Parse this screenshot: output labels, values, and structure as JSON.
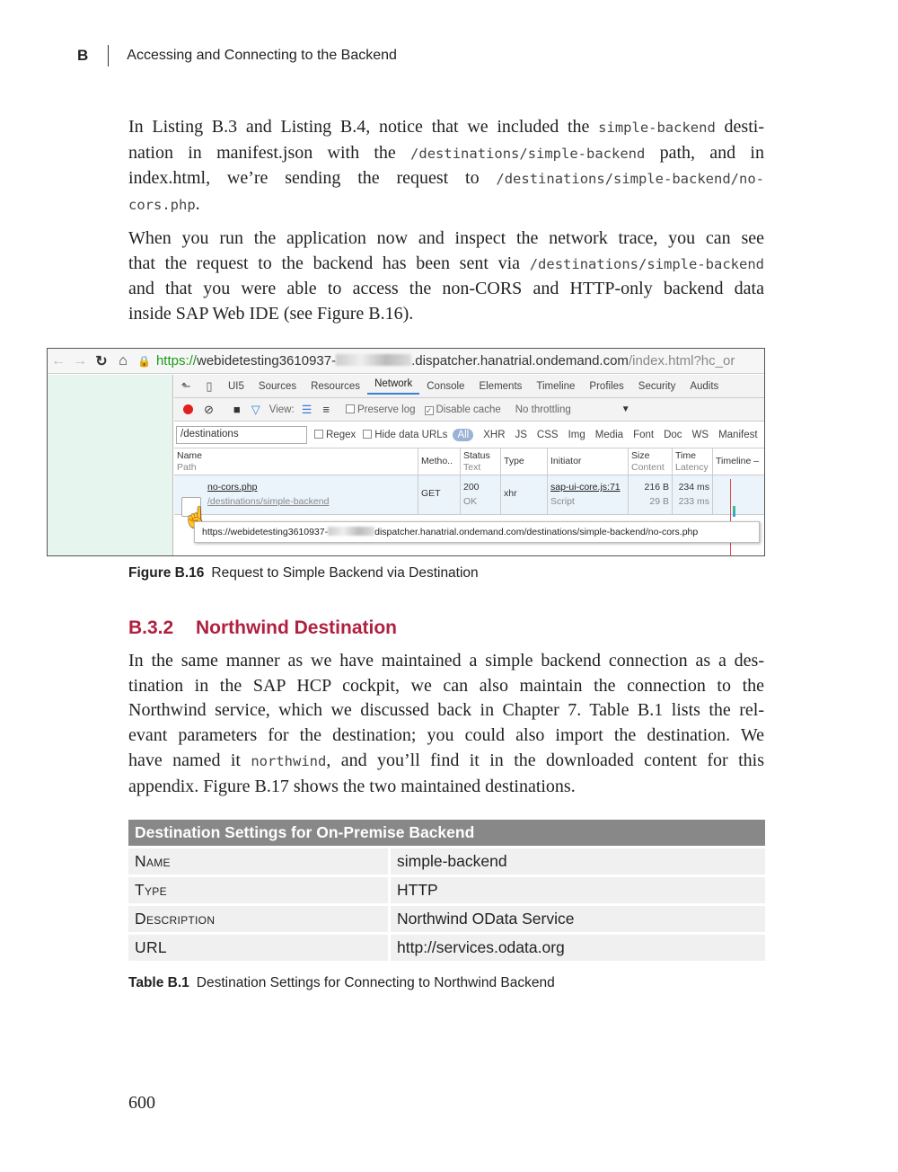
{
  "header": {
    "chapter_letter": "B",
    "chapter_title": "Accessing and Connecting to the Backend"
  },
  "para1": {
    "l1a": "In Listing B.3 and Listing B.4, notice that we included the ",
    "l1code": "simple-backend",
    "l1b": " desti-",
    "l2a": "nation in manifest.json with the ",
    "l2code": "/destinations/simple-backend",
    "l2b": " path, and in",
    "l3a": "index.html, we’re sending the request to ",
    "l3code": "/destinations/simple-backend/no-",
    "l4code": "cors.php",
    "l4b": "."
  },
  "para2": {
    "l1": "When you run the application now and inspect the network trace, you can see",
    "l2a": "that the request to the backend has been sent via ",
    "l2code": "/destinations/simple-backend",
    "l3": "and that you were able to access the non-CORS and HTTP-only backend data",
    "l4": "inside SAP Web IDE (see Figure B.16)."
  },
  "screenshot": {
    "url_scheme": "https://",
    "url_host_a": "webidetesting3610937-",
    "url_host_b": ".dispatcher.hanatrial.ondemand.com",
    "url_path": "/index.html?hc_or",
    "tabs": [
      "UI5",
      "Sources",
      "Resources",
      "Network",
      "Console",
      "Elements",
      "Timeline",
      "Profiles",
      "Security",
      "Audits"
    ],
    "toolbar": {
      "view": "View:",
      "preserve_log": "Preserve log",
      "disable_cache": "Disable cache",
      "throttle": "No throttling"
    },
    "filter": {
      "value": "/destinations",
      "regex": "Regex",
      "hide_data": "Hide data URLs",
      "all": "All",
      "types": [
        "XHR",
        "JS",
        "CSS",
        "Img",
        "Media",
        "Font",
        "Doc",
        "WS",
        "Manifest"
      ]
    },
    "columns": {
      "name": "Name",
      "name_sub": "Path",
      "method": "Metho..",
      "status": "Status",
      "status_sub": "Text",
      "type": "Type",
      "initiator": "Initiator",
      "size": "Size",
      "size_sub": "Content",
      "time": "Time",
      "time_sub": "Latency",
      "timeline": "Timeline –"
    },
    "row": {
      "name": "no-cors.php",
      "path": "/destinations/simple-backend",
      "method": "GET",
      "status": "200",
      "status_text": "OK",
      "type": "xhr",
      "initiator": "sap-ui-core.js:71",
      "initiator_sub": "Script",
      "size": "216 B",
      "size_content": "29 B",
      "time": "234 ms",
      "latency": "233 ms"
    },
    "tooltip_a": "https://webidetesting3610937-",
    "tooltip_b": "dispatcher.hanatrial.ondemand.com/destinations/simple-backend/no-cors.php"
  },
  "figure_caption": {
    "label": "Figure B.16",
    "text": "Request to Simple Backend via Destination"
  },
  "section": {
    "number": "B.3.2",
    "title": "Northwind Destination"
  },
  "para3": {
    "l1": "In the same manner as we have maintained a simple backend connection as a des-",
    "l2": "tination in the SAP HCP cockpit, we can also maintain the connection to the",
    "l3": "Northwind service, which we discussed back in Chapter 7. Table B.1 lists the rel-",
    "l4": "evant parameters for the destination; you could also import the destination. We",
    "l5a": "have named it ",
    "l5code": "northwind",
    "l5b": ", and you’ll find it in the downloaded content for this",
    "l6": "appendix. Figure B.17 shows the two maintained destinations."
  },
  "table": {
    "header": "Destination Settings for On-Premise Backend",
    "rows": [
      {
        "key": "Name",
        "value": "simple-backend"
      },
      {
        "key": "Type",
        "value": "HTTP"
      },
      {
        "key": "Description",
        "value": "Northwind OData Service"
      },
      {
        "key": "URL",
        "value": "http://services.odata.org"
      }
    ]
  },
  "table_caption": {
    "label": "Table B.1",
    "text": "Destination Settings for Connecting to Northwind Backend"
  },
  "page_number": "600"
}
